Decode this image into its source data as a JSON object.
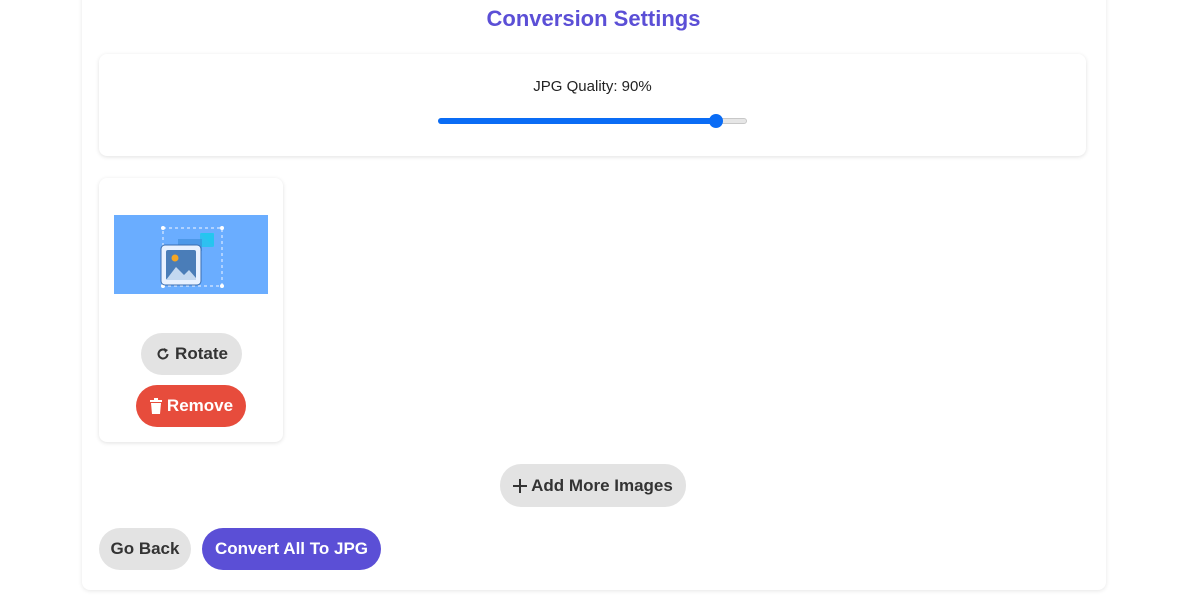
{
  "settings": {
    "title": "Conversion Settings",
    "quality_label": "JPG Quality: 90%",
    "quality_value": 0.9
  },
  "image_card": {
    "thumbnail_icon": "image-placeholder-icon",
    "rotate_label": "Rotate",
    "rotate_icon": "rotate-icon",
    "remove_label": "Remove",
    "remove_icon": "trash-icon"
  },
  "actions": {
    "add_more_label": "Add More Images",
    "add_icon": "plus-icon",
    "go_back_label": "Go Back",
    "convert_label": "Convert All To JPG"
  },
  "colors": {
    "accent": "#5b4fd6",
    "slider": "#0a6cf5",
    "remove": "#e74c3c",
    "thumbnail_bg": "#6aadff"
  }
}
